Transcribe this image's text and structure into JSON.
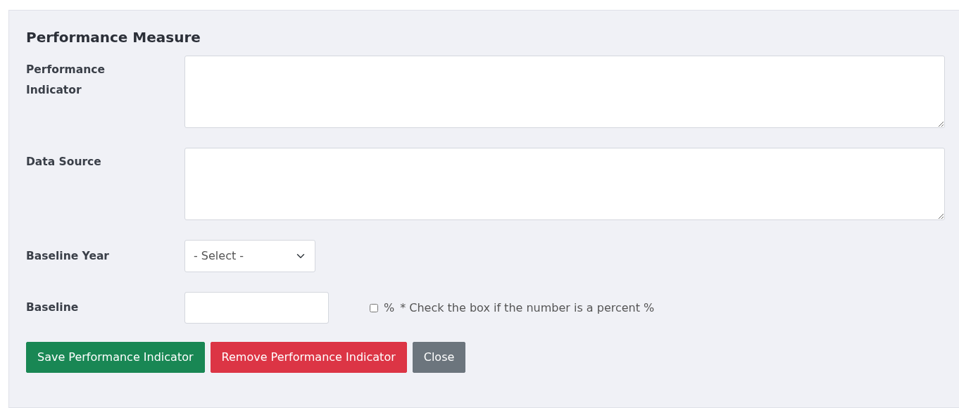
{
  "title": "Performance Measure",
  "fields": [
    {
      "kind": "textarea",
      "label": "Performance Indicator"
    },
    {
      "kind": "textarea",
      "label": "Data Source"
    },
    {
      "kind": "select",
      "label": "Baseline Year",
      "value": "- Select -"
    },
    {
      "kind": "text",
      "label": "Baseline",
      "checkbox": {
        "checked": false,
        "label": "%"
      },
      "note": "* Check the box if the number is a percent %"
    }
  ],
  "buttons": [
    {
      "kind": "success",
      "label": "Save Performance Indicator"
    },
    {
      "kind": "danger",
      "label": "Remove Performance Indicator"
    },
    {
      "kind": "secondary",
      "label": "Close"
    }
  ]
}
